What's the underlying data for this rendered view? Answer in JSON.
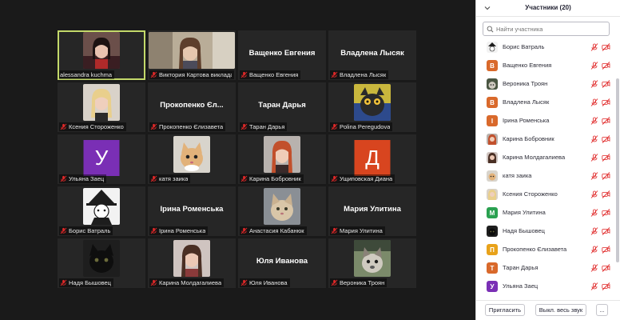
{
  "gallery": {
    "tiles": [
      {
        "name": "alessandra kuchma"
      },
      {
        "name": "Виктория Картова викладач, ..."
      },
      {
        "name": "Ващенко Евгения",
        "big": "Ващенко Евгения"
      },
      {
        "name": "Владлена Лысяк",
        "big": "Владлена Лысяк"
      },
      {
        "name": "Ксения Стороженко"
      },
      {
        "name": "Прокопенко Єлизавета",
        "big": "Прокопенко Єл..."
      },
      {
        "name": "Таран Дарья",
        "big": "Таран Дарья"
      },
      {
        "name": "Polina Peregudova"
      },
      {
        "name": "Ульяна Заец",
        "letter": "У"
      },
      {
        "name": "катя заика"
      },
      {
        "name": "Карина Бобровник"
      },
      {
        "name": "Ущиповская Диана",
        "letter": "Д"
      },
      {
        "name": "Борис Ватраль"
      },
      {
        "name": "Ірина Роменська",
        "big": "Ірина Роменська"
      },
      {
        "name": "Анастасия Кабанюк"
      },
      {
        "name": "Мария Улитина",
        "big": "Мария Улитина"
      },
      {
        "name": "Надя Бышовец"
      },
      {
        "name": "Карина Молдагалиева"
      },
      {
        "name": "Юля Иванова",
        "big": "Юля Иванова"
      },
      {
        "name": "Вероника Троян"
      }
    ]
  },
  "sidebar": {
    "title": "Участники (20)",
    "search_placeholder": "Найти участника",
    "participants": [
      {
        "name": "Борис Ватраль"
      },
      {
        "name": "Ващенко Евгения",
        "letter": "В"
      },
      {
        "name": "Вероника Троян"
      },
      {
        "name": "Владлена Лысяк",
        "letter": "В"
      },
      {
        "name": "Ірина Роменська",
        "letter": "І"
      },
      {
        "name": "Карина Бобровник"
      },
      {
        "name": "Карина Молдагалиева"
      },
      {
        "name": "катя заика"
      },
      {
        "name": "Ксения Стороженко"
      },
      {
        "name": "Мария Улитина",
        "letter": "М"
      },
      {
        "name": "Надя Бышовец"
      },
      {
        "name": "Прокопенко Єлизавета",
        "letter": "П"
      },
      {
        "name": "Таран Дарья",
        "letter": "Т"
      },
      {
        "name": "Ульяна Заец",
        "letter": "У"
      }
    ],
    "invite_label": "Пригласить",
    "mute_all_label": "Выкл. весь звук",
    "more_label": "..."
  },
  "colors": {
    "active_border": "#c3d96a",
    "muted_red": "#e02828",
    "avatar_orange": "#d9692b",
    "avatar_green": "#2aa150",
    "avatar_purple": "#7a2fb5",
    "avatar_red": "#d8451f",
    "avatar_amber": "#e8a21a"
  },
  "icons": {
    "mic_muted": "mic-muted-icon",
    "video_off": "video-off-icon",
    "search": "search-icon",
    "collapse": "chevron-down-icon"
  }
}
